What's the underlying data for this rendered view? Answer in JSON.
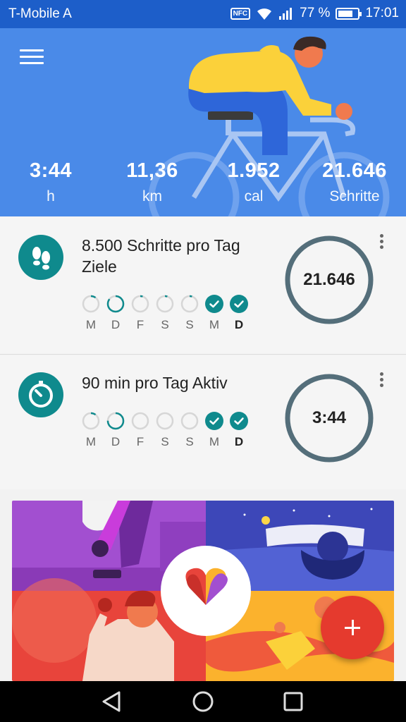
{
  "status_bar": {
    "carrier": "T-Mobile A",
    "nfc": "NFC",
    "battery_percent": "77 %",
    "battery_level": 0.77,
    "time": "17:01"
  },
  "header": {
    "stats": [
      {
        "value": "3:44",
        "unit": "h"
      },
      {
        "value": "11,36",
        "unit": "km"
      },
      {
        "value": "1.952",
        "unit": "cal"
      },
      {
        "value": "21.646",
        "unit": "Schritte"
      }
    ]
  },
  "goals": [
    {
      "title": "8.500 Schritte pro Tag Ziele",
      "value": "21.646",
      "icon": "footsteps-icon",
      "days": [
        {
          "label": "M",
          "progress": 0.1,
          "done": false,
          "today": false
        },
        {
          "label": "D",
          "progress": 0.85,
          "done": false,
          "today": false
        },
        {
          "label": "F",
          "progress": 0.05,
          "done": false,
          "today": false
        },
        {
          "label": "S",
          "progress": 0.05,
          "done": false,
          "today": false
        },
        {
          "label": "S",
          "progress": 0.05,
          "done": false,
          "today": false
        },
        {
          "label": "M",
          "progress": 1,
          "done": true,
          "today": false
        },
        {
          "label": "D",
          "progress": 1,
          "done": true,
          "today": true
        }
      ]
    },
    {
      "title": "90 min pro Tag Aktiv",
      "value": "3:44",
      "icon": "timer-icon",
      "days": [
        {
          "label": "M",
          "progress": 0.1,
          "done": false,
          "today": false
        },
        {
          "label": "D",
          "progress": 0.75,
          "done": false,
          "today": false
        },
        {
          "label": "F",
          "progress": 0,
          "done": false,
          "today": false
        },
        {
          "label": "S",
          "progress": 0,
          "done": false,
          "today": false
        },
        {
          "label": "S",
          "progress": 0,
          "done": false,
          "today": false
        },
        {
          "label": "M",
          "progress": 1,
          "done": true,
          "today": false
        },
        {
          "label": "D",
          "progress": 1,
          "done": true,
          "today": true
        }
      ]
    }
  ],
  "colors": {
    "header_bg": "#4a8ae8",
    "status_bg": "#1d5ec9",
    "goal_teal": "#0f8a8d",
    "ring": "#546e7a",
    "fab": "#e53a2e"
  }
}
